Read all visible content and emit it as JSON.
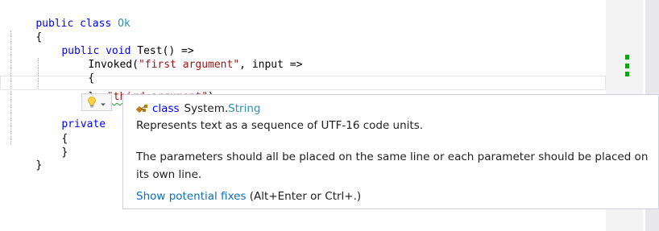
{
  "code": {
    "line1": {
      "kw": "public class",
      "name": "Ok"
    },
    "line2": "{",
    "line3": {
      "kw1": "public",
      "kw2": "void",
      "rest": "Test() =>"
    },
    "line4": {
      "pre": "Invoked(",
      "str": "\"first argument\"",
      "post": ", input =>"
    },
    "line5": "{",
    "line6": {
      "pre": "}, ",
      "str": "\"third argument\"",
      "post": ");"
    },
    "line7": {
      "kw": "private"
    },
    "line8": "{",
    "line9": "}",
    "line10": "}"
  },
  "tooltip": {
    "header_prefix": "class",
    "header_namespace": "System.",
    "header_type": "String",
    "summary": "Represents text as a sequence of UTF-16 code units.",
    "diagnostic": "The parameters should all be placed on the same line or each parameter should be placed on its own line.",
    "fix_link": "Show potential fixes",
    "fix_shortcut": "(Alt+Enter or Ctrl+.)"
  },
  "icons": {
    "lightbulb": "lightbulb-icon",
    "dropdown": "chevron-down-icon",
    "class": "class-icon"
  },
  "colors": {
    "keyword": "#0000ff",
    "string": "#a31515",
    "type": "#2b91af",
    "link": "#0e70c0",
    "squiggle": "#2ca02c"
  }
}
